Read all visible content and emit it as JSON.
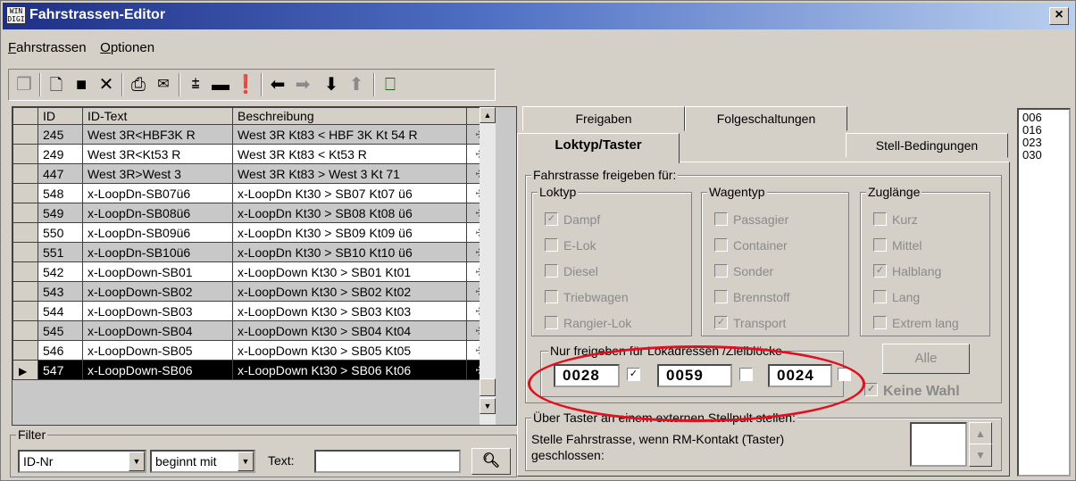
{
  "window": {
    "title": "Fahrstrassen-Editor",
    "icon_text": "WIN DIGI",
    "close_label": "×"
  },
  "menu": [
    {
      "label": "Fahrstrassen"
    },
    {
      "label": "Optionen"
    }
  ],
  "toolbar": {
    "buttons": [
      "copy-icon",
      "new-document-icon",
      "save-icon",
      "delete-icon",
      "print-icon",
      "stamp-icon",
      "route-icon",
      "block-icon",
      "warning-icon",
      "arrow-left-icon",
      "arrow-right-icon",
      "arrow-down-icon",
      "arrow-up-icon",
      "exit-icon"
    ]
  },
  "grid": {
    "headers": {
      "id": "ID",
      "id_text": "ID-Text",
      "description": "Beschreibung"
    },
    "rows": [
      {
        "id": "245",
        "id_text": "West 3R<HBF3K R",
        "description": "West 3R Kt83 < HBF 3K Kt 54 R",
        "shade": "grey"
      },
      {
        "id": "249",
        "id_text": "West 3R<Kt53 R",
        "description": "West 3R Kt83 < Kt53 R",
        "shade": "white"
      },
      {
        "id": "447",
        "id_text": "West 3R>West 3",
        "description": "West 3R Kt83 > West 3 Kt 71",
        "shade": "grey"
      },
      {
        "id": "548",
        "id_text": "x-LoopDn-SB07ü6",
        "description": "x-LoopDn Kt30 > SB07 Kt07 ü6",
        "shade": "white"
      },
      {
        "id": "549",
        "id_text": "x-LoopDn-SB08ü6",
        "description": "x-LoopDn Kt30 > SB08 Kt08 ü6",
        "shade": "grey"
      },
      {
        "id": "550",
        "id_text": "x-LoopDn-SB09ü6",
        "description": "x-LoopDn Kt30 > SB09 Kt09 ü6",
        "shade": "white"
      },
      {
        "id": "551",
        "id_text": "x-LoopDn-SB10ü6",
        "description": "x-LoopDn Kt30 > SB10 Kt10 ü6",
        "shade": "grey"
      },
      {
        "id": "542",
        "id_text": "x-LoopDown-SB01",
        "description": "x-LoopDown Kt30 > SB01 Kt01",
        "shade": "white"
      },
      {
        "id": "543",
        "id_text": "x-LoopDown-SB02",
        "description": "x-LoopDown Kt30 > SB02 Kt02",
        "shade": "grey"
      },
      {
        "id": "544",
        "id_text": "x-LoopDown-SB03",
        "description": "x-LoopDown Kt30 > SB03 Kt03",
        "shade": "white"
      },
      {
        "id": "545",
        "id_text": "x-LoopDown-SB04",
        "description": "x-LoopDown Kt30 > SB04 Kt04",
        "shade": "grey"
      },
      {
        "id": "546",
        "id_text": "x-LoopDown-SB05",
        "description": "x-LoopDown Kt30 > SB05 Kt05",
        "shade": "white"
      },
      {
        "id": "547",
        "id_text": "x-LoopDown-SB06",
        "description": "x-LoopDown Kt30 > SB06 Kt06",
        "shade": "active"
      }
    ]
  },
  "filter": {
    "legend": "Filter",
    "field": "ID-Nr",
    "mode": "beginnt mit",
    "text_label": "Text:",
    "text_value": ""
  },
  "tabs": {
    "freigaben": "Freigaben",
    "folgeschaltungen": "Folgeschaltungen",
    "loktyp": "Loktyp/Taster",
    "stell": "Stell-Bedingungen"
  },
  "panel": {
    "release_legend": "Fahrstrasse freigeben für:",
    "loktyp": {
      "legend": "Loktyp",
      "items": [
        {
          "label": "Dampf",
          "checked": true
        },
        {
          "label": "E-Lok",
          "checked": false
        },
        {
          "label": "Diesel",
          "checked": false
        },
        {
          "label": "Triebwagen",
          "checked": false
        },
        {
          "label": "Rangier-Lok",
          "checked": false
        }
      ]
    },
    "wagentyp": {
      "legend": "Wagentyp",
      "items": [
        {
          "label": "Passagier",
          "checked": false
        },
        {
          "label": "Container",
          "checked": false
        },
        {
          "label": "Sonder",
          "checked": false
        },
        {
          "label": "Brennstoff",
          "checked": false
        },
        {
          "label": "Transport",
          "checked": true
        }
      ]
    },
    "zuglaenge": {
      "legend": "Zuglänge",
      "items": [
        {
          "label": "Kurz",
          "checked": false
        },
        {
          "label": "Mittel",
          "checked": false
        },
        {
          "label": "Halblang",
          "checked": true
        },
        {
          "label": "Lang",
          "checked": false
        },
        {
          "label": "Extrem lang",
          "checked": false
        }
      ]
    },
    "addresses": {
      "legend": "Nur freigeben für Lokadressen /Zielblöcke",
      "values": [
        {
          "value": "0028",
          "checked": true
        },
        {
          "value": "0059",
          "checked": false
        },
        {
          "value": "0024",
          "checked": false
        }
      ]
    },
    "alle_button": "Alle",
    "keine_wahl": {
      "label": "Keine Wahl",
      "checked": true
    },
    "taster": {
      "legend": "Über Taster an einem externen Stellpult stellen:",
      "text_line1": "Stelle Fahrstrasse, wenn RM-Kontakt (Taster)",
      "text_line2": "geschlossen:",
      "spin_value": ""
    }
  },
  "side_list": [
    "006",
    "016",
    "023",
    "030"
  ],
  "colors": {
    "title_start": "#1e2f86",
    "title_end": "#b9cfee",
    "highlight_ellipse": "#e01020",
    "face": "#d4d0c8"
  }
}
